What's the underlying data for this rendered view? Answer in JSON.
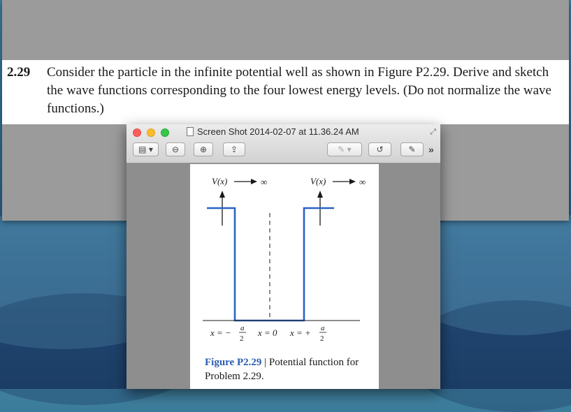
{
  "problem": {
    "number": "2.29",
    "text": "Consider the particle in the infinite potential well as shown in Figure P2.29. Derive and sketch the wave functions corresponding to the four lowest energy levels. (Do not normalize the wave functions.)"
  },
  "preview": {
    "title": "Screen Shot 2014-02-07 at 11.36.24 AM",
    "icons": [
      "sidebar-toggle-icon",
      "zoom-out-icon",
      "zoom-in-icon",
      "share-icon",
      "annotate-pen-icon",
      "rotate-icon",
      "edit-toolbar-icon"
    ]
  },
  "figure": {
    "left_label": "V(x)",
    "right_label": "V(x)",
    "infinity": "∞",
    "x_left_prefix": "x = −",
    "x_mid": "x = 0",
    "x_right_prefix": "x = +",
    "frac_num": "a",
    "frac_den": "2",
    "caption_label": "Figure P2.29",
    "caption_sep": " | ",
    "caption_text": "Potential function for Problem 2.29."
  }
}
